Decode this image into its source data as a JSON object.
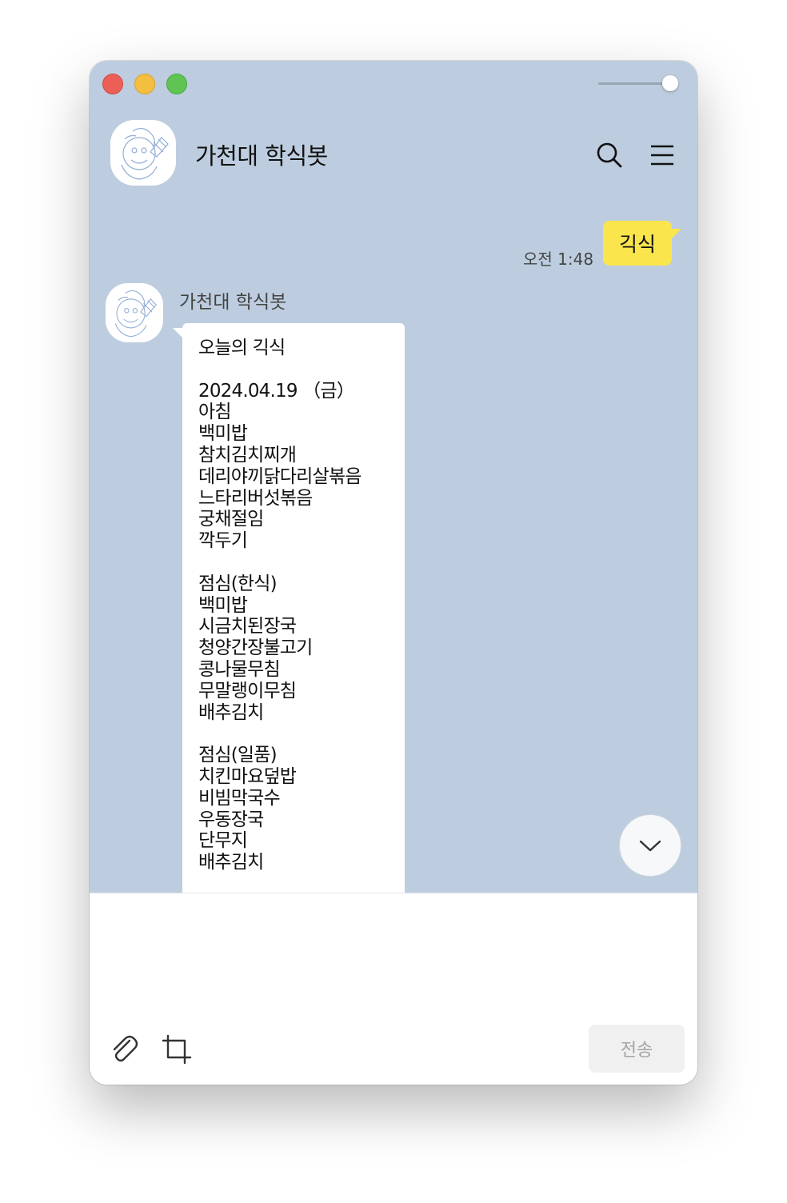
{
  "chat": {
    "title": "가천대 학식봇",
    "sender_name": "가천대 학식봇"
  },
  "messages": {
    "outgoing": {
      "text": "긱식",
      "time": "오전 1:48"
    },
    "incoming": {
      "text": "오늘의 긱식\n\n2024.04.19 （금）\n아침\n백미밥\n참치김치찌개\n데리야끼닭다리살볶음\n느타리버섯볶음\n궁채절임\n깍두기\n\n점심(한식)\n백미밥\n시금치된장국\n청양간장불고기\n콩나물무침\n무말랭이무침\n배추김치\n\n점심(일품)\n치킨마요덮밥\n비빔막국수\n우동장국\n단무지\n배추김치"
    }
  },
  "input": {
    "value": "",
    "send_label": "전송"
  },
  "icons": {
    "search": "search-icon",
    "menu": "hamburger-menu-icon",
    "scroll_down": "chevron-down-icon",
    "attach": "paperclip-icon",
    "capture": "crop-icon"
  },
  "colors": {
    "chat_background": "#bdcddf",
    "my_bubble": "#fae54d",
    "their_bubble": "#ffffff",
    "send_button": "#f0f0f0"
  }
}
